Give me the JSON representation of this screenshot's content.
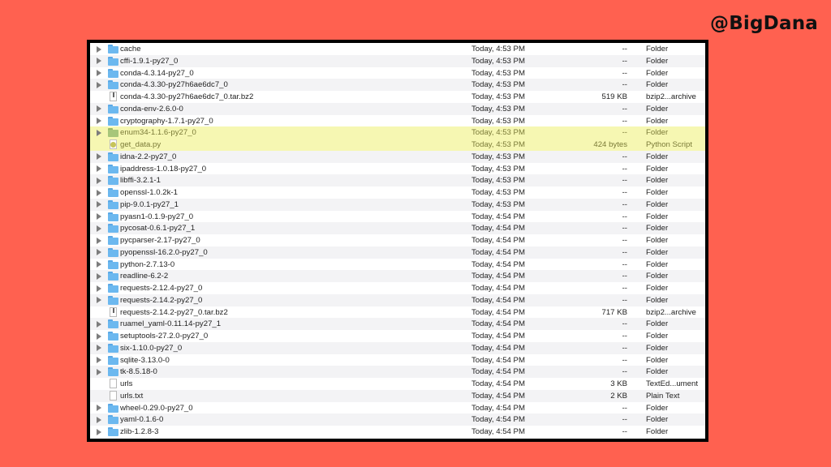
{
  "handle": "@BigDana",
  "files": [
    {
      "name": "cache",
      "date": "Today, 4:53 PM",
      "size": "--",
      "kind": "Folder",
      "type": "folder"
    },
    {
      "name": "cffi-1.9.1-py27_0",
      "date": "Today, 4:53 PM",
      "size": "--",
      "kind": "Folder",
      "type": "folder"
    },
    {
      "name": "conda-4.3.14-py27_0",
      "date": "Today, 4:53 PM",
      "size": "--",
      "kind": "Folder",
      "type": "folder"
    },
    {
      "name": "conda-4.3.30-py27h6ae6dc7_0",
      "date": "Today, 4:53 PM",
      "size": "--",
      "kind": "Folder",
      "type": "folder"
    },
    {
      "name": "conda-4.3.30-py27h6ae6dc7_0.tar.bz2",
      "date": "Today, 4:53 PM",
      "size": "519 KB",
      "kind": "bzip2...archive",
      "type": "archive"
    },
    {
      "name": "conda-env-2.6.0-0",
      "date": "Today, 4:53 PM",
      "size": "--",
      "kind": "Folder",
      "type": "folder"
    },
    {
      "name": "cryptography-1.7.1-py27_0",
      "date": "Today, 4:53 PM",
      "size": "--",
      "kind": "Folder",
      "type": "folder"
    },
    {
      "name": "enum34-1.1.6-py27_0",
      "date": "Today, 4:53 PM",
      "size": "--",
      "kind": "Folder",
      "type": "folder",
      "highlight": true
    },
    {
      "name": "get_data.py",
      "date": "Today, 4:53 PM",
      "size": "424 bytes",
      "kind": "Python Script",
      "type": "script",
      "highlight": true
    },
    {
      "name": "idna-2.2-py27_0",
      "date": "Today, 4:53 PM",
      "size": "--",
      "kind": "Folder",
      "type": "folder"
    },
    {
      "name": "ipaddress-1.0.18-py27_0",
      "date": "Today, 4:53 PM",
      "size": "--",
      "kind": "Folder",
      "type": "folder"
    },
    {
      "name": "libffi-3.2.1-1",
      "date": "Today, 4:53 PM",
      "size": "--",
      "kind": "Folder",
      "type": "folder"
    },
    {
      "name": "openssl-1.0.2k-1",
      "date": "Today, 4:53 PM",
      "size": "--",
      "kind": "Folder",
      "type": "folder"
    },
    {
      "name": "pip-9.0.1-py27_1",
      "date": "Today, 4:53 PM",
      "size": "--",
      "kind": "Folder",
      "type": "folder"
    },
    {
      "name": "pyasn1-0.1.9-py27_0",
      "date": "Today, 4:54 PM",
      "size": "--",
      "kind": "Folder",
      "type": "folder"
    },
    {
      "name": "pycosat-0.6.1-py27_1",
      "date": "Today, 4:54 PM",
      "size": "--",
      "kind": "Folder",
      "type": "folder"
    },
    {
      "name": "pycparser-2.17-py27_0",
      "date": "Today, 4:54 PM",
      "size": "--",
      "kind": "Folder",
      "type": "folder"
    },
    {
      "name": "pyopenssl-16.2.0-py27_0",
      "date": "Today, 4:54 PM",
      "size": "--",
      "kind": "Folder",
      "type": "folder"
    },
    {
      "name": "python-2.7.13-0",
      "date": "Today, 4:54 PM",
      "size": "--",
      "kind": "Folder",
      "type": "folder"
    },
    {
      "name": "readline-6.2-2",
      "date": "Today, 4:54 PM",
      "size": "--",
      "kind": "Folder",
      "type": "folder"
    },
    {
      "name": "requests-2.12.4-py27_0",
      "date": "Today, 4:54 PM",
      "size": "--",
      "kind": "Folder",
      "type": "folder"
    },
    {
      "name": "requests-2.14.2-py27_0",
      "date": "Today, 4:54 PM",
      "size": "--",
      "kind": "Folder",
      "type": "folder"
    },
    {
      "name": "requests-2.14.2-py27_0.tar.bz2",
      "date": "Today, 4:54 PM",
      "size": "717 KB",
      "kind": "bzip2...archive",
      "type": "archive"
    },
    {
      "name": "ruamel_yaml-0.11.14-py27_1",
      "date": "Today, 4:54 PM",
      "size": "--",
      "kind": "Folder",
      "type": "folder"
    },
    {
      "name": "setuptools-27.2.0-py27_0",
      "date": "Today, 4:54 PM",
      "size": "--",
      "kind": "Folder",
      "type": "folder"
    },
    {
      "name": "six-1.10.0-py27_0",
      "date": "Today, 4:54 PM",
      "size": "--",
      "kind": "Folder",
      "type": "folder"
    },
    {
      "name": "sqlite-3.13.0-0",
      "date": "Today, 4:54 PM",
      "size": "--",
      "kind": "Folder",
      "type": "folder"
    },
    {
      "name": "tk-8.5.18-0",
      "date": "Today, 4:54 PM",
      "size": "--",
      "kind": "Folder",
      "type": "folder"
    },
    {
      "name": "urls",
      "date": "Today, 4:54 PM",
      "size": "3 KB",
      "kind": "TextEd...ument",
      "type": "doc"
    },
    {
      "name": "urls.txt",
      "date": "Today, 4:54 PM",
      "size": "2 KB",
      "kind": "Plain Text",
      "type": "doc"
    },
    {
      "name": "wheel-0.29.0-py27_0",
      "date": "Today, 4:54 PM",
      "size": "--",
      "kind": "Folder",
      "type": "folder"
    },
    {
      "name": "yaml-0.1.6-0",
      "date": "Today, 4:54 PM",
      "size": "--",
      "kind": "Folder",
      "type": "folder"
    },
    {
      "name": "zlib-1.2.8-3",
      "date": "Today, 4:54 PM",
      "size": "--",
      "kind": "Folder",
      "type": "folder"
    }
  ]
}
